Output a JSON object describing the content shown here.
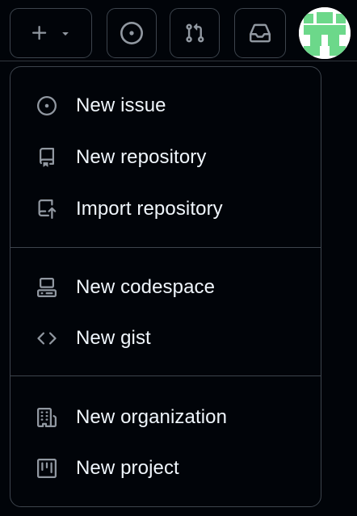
{
  "header": {
    "create_icon": "plus-icon",
    "create_caret_icon": "triangle-down-icon",
    "issues_icon": "issue-opened-icon",
    "pulls_icon": "git-pull-request-icon",
    "inbox_icon": "inbox-icon",
    "avatar_icon": "identicon"
  },
  "menu": {
    "groups": [
      {
        "items": [
          {
            "label": "New issue",
            "icon": "issue-opened-icon"
          },
          {
            "label": "New repository",
            "icon": "repo-icon"
          },
          {
            "label": "Import repository",
            "icon": "repo-push-icon"
          }
        ]
      },
      {
        "items": [
          {
            "label": "New codespace",
            "icon": "codespaces-icon"
          },
          {
            "label": "New gist",
            "icon": "code-icon"
          }
        ]
      },
      {
        "items": [
          {
            "label": "New organization",
            "icon": "organization-icon"
          },
          {
            "label": "New project",
            "icon": "project-icon"
          }
        ]
      }
    ]
  },
  "colors": {
    "background": "#010409",
    "border": "#3d444d",
    "text": "#f0f6fc",
    "icon": "#9198a1",
    "avatar_green": "#6cd88a"
  }
}
